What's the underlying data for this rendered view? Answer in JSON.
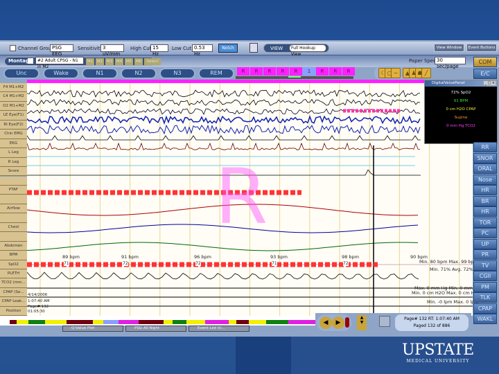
{
  "toolbar": {
    "channel_group_label": "Channel Group",
    "channel_group_value": "PSG EEG",
    "sensitivity_label": "Sensitivity",
    "sensitivity_value": "3 uV/mm",
    "high_cut_label": "High Cut",
    "high_cut_value": "15 Hz",
    "low_cut_label": "Low Cut",
    "low_cut_value": "0.53 Hz",
    "notch_label": "Notch",
    "view_label": "VIEW",
    "view_value": "Full Hookup View",
    "view_window": "View Window",
    "event_buttons": "Event Buttons"
  },
  "montage": {
    "label": "Montage",
    "value": "#2 Adult CPSG - N1 in M2",
    "slots": [
      "M1",
      "M2",
      "M3",
      "M4",
      "M5",
      "M6",
      "Select"
    ]
  },
  "paper_speed": {
    "label": "Paper Speed",
    "value": "30 sec/page"
  },
  "stages": [
    "Unc",
    "Wake",
    "N1",
    "N2",
    "N3",
    "REM"
  ],
  "epochs": [
    "R",
    "R",
    "R",
    "R",
    "R",
    "1",
    "R",
    "R",
    "R"
  ],
  "tool_icons": [
    "moon-icon",
    "circle-icon",
    "wave-icon",
    "person-up-icon",
    "person-icon",
    "person-sit-icon",
    "leg-icon"
  ],
  "right_buttons": [
    "COM",
    "E/C",
    "RR",
    "SNOR",
    "ORAL",
    "Nose",
    "HR",
    "BR",
    "HR",
    "TOR",
    "PC",
    "UP",
    "PR",
    "TV",
    "CGII",
    "PM",
    "TLK",
    "CPAP",
    "WAKL"
  ],
  "channels": [
    "F4 M1+M2",
    "C4 M1+M2",
    "O2 M1+M2",
    "LE Eye(F1)",
    "RI Eye(F2)",
    "Chin EMG",
    "EKG",
    "L Leg",
    "R Leg",
    "Snore",
    "",
    "PTAF",
    "",
    "Airflow",
    "",
    "Chest",
    "",
    "Abdomen",
    "BPM",
    "SpO2",
    "PLETH",
    "TCO2 (mm...",
    "CPAP (Se...",
    "CPAP Leak...",
    "Position"
  ],
  "stage_mark": "R",
  "bpm_labels": [
    "89 bpm",
    "91 bpm",
    "96 bpm",
    "93 bpm",
    "98 bpm"
  ],
  "spo2_labels": [
    "71",
    "72",
    "72",
    "71",
    "72"
  ],
  "stats": {
    "bpm_now": "90 bpm",
    "bpm_range": "Min. 80 bpm  Max. 99 bpm",
    "spo2": "Min. 71%  Avg. 72%",
    "tco2": "Max. 0 mm Hg  Min. 0 mm Hg",
    "cpap": "Min. 0 cm H2O  Max. 0 cm H2O",
    "leak": "Min. -0 lpm  Max. 0 lpm"
  },
  "info": {
    "date": "4/14/2006",
    "time": "1:07:40 AM",
    "page": "Page# 132",
    "elapsed": "01:05:30"
  },
  "status": {
    "line1": "Page# 132  RT: 1:07:40 AM",
    "line2": "Paged 132 of 886"
  },
  "digital_panel": {
    "title": "DigitalValuePanel",
    "items": [
      {
        "text": "72% SpO2",
        "color": "#ffffff"
      },
      {
        "text": "91 BPM",
        "color": "#30e030"
      },
      {
        "text": "0 cm H2O CPAP",
        "color": "#f0f040"
      },
      {
        "text": "Supine",
        "color": "#ff9a30"
      },
      {
        "text": "0 mm Hg TCO2",
        "color": "#ff40ff"
      }
    ]
  },
  "taskbar": [
    "Q-Value Plot",
    "PSG All Night",
    "Event List Vi..."
  ],
  "hypnogram_colors": {
    "wake": "#f0f000",
    "rem": "#e020e0",
    "n2": "#108010",
    "n3": "#700010",
    "n1": "#8aa0ff"
  },
  "logo": {
    "name": "UPSTATE",
    "sub": "MEDICAL UNIVERSITY"
  }
}
